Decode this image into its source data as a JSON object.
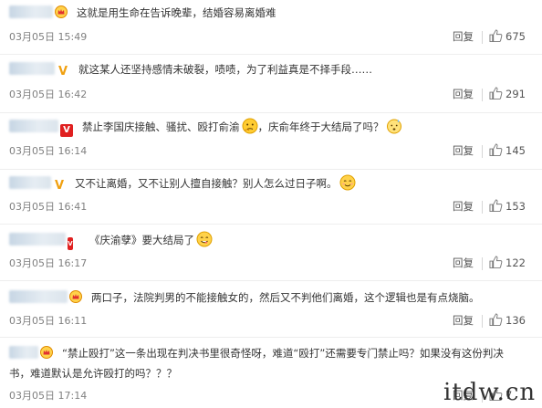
{
  "comments": [
    {
      "text": "这就是用生命在告诉晚辈，结婚容易离婚难",
      "time": "03月05日 15:49",
      "reply": "回复",
      "likes": "675",
      "badge": "crown"
    },
    {
      "text": "就这某人还坚持感情未破裂，啧啧，为了利益真是不择手段……",
      "time": "03月05日 16:42",
      "reply": "回复",
      "likes": "291",
      "badge": "v-gold"
    },
    {
      "text_a": "禁止李国庆接触、骚扰、殴打俞渝",
      "text_b": "，庆俞年终于大结局了吗？",
      "time": "03月05日 16:14",
      "reply": "回复",
      "likes": "145",
      "badge": "v-red"
    },
    {
      "text": "又不让离婚，又不让别人擅自接触？别人怎么过日子啊。",
      "time": "03月05日 16:41",
      "reply": "回复",
      "likes": "153",
      "badge": "v-gold"
    },
    {
      "text": "《庆渝孽》要大结局了",
      "time": "03月05日 16:17",
      "reply": "回复",
      "likes": "122",
      "badge": "v-red"
    },
    {
      "text": "两口子，法院判男的不能接触女的，然后又不判他们离婚，这个逻辑也是有点烧脑。",
      "time": "03月05日 16:11",
      "reply": "回复",
      "likes": "136",
      "badge": "crown"
    },
    {
      "text_line1": "“禁止殴打”这一条出现在判决书里很奇怪呀，难道“殴打”还需要专门禁止吗？如果没有这份判决",
      "text_line2": "书，难道默认是允许殴打的吗？？？",
      "time": "03月05日 17:14",
      "reply": "回复",
      "likes": "7",
      "badge": "crown"
    }
  ],
  "watermark": "itdw.cn",
  "colors": {
    "accent_red": "#e02020",
    "badge_gold": "#f0a010",
    "meta_gray": "#808080"
  },
  "icons": [
    "crown-badge-icon",
    "verified-v-icon",
    "thumbs-up-icon",
    "emoji-thinking-icon",
    "emoji-blush-icon",
    "emoji-sweat-icon",
    "emoji-yum-icon"
  ]
}
